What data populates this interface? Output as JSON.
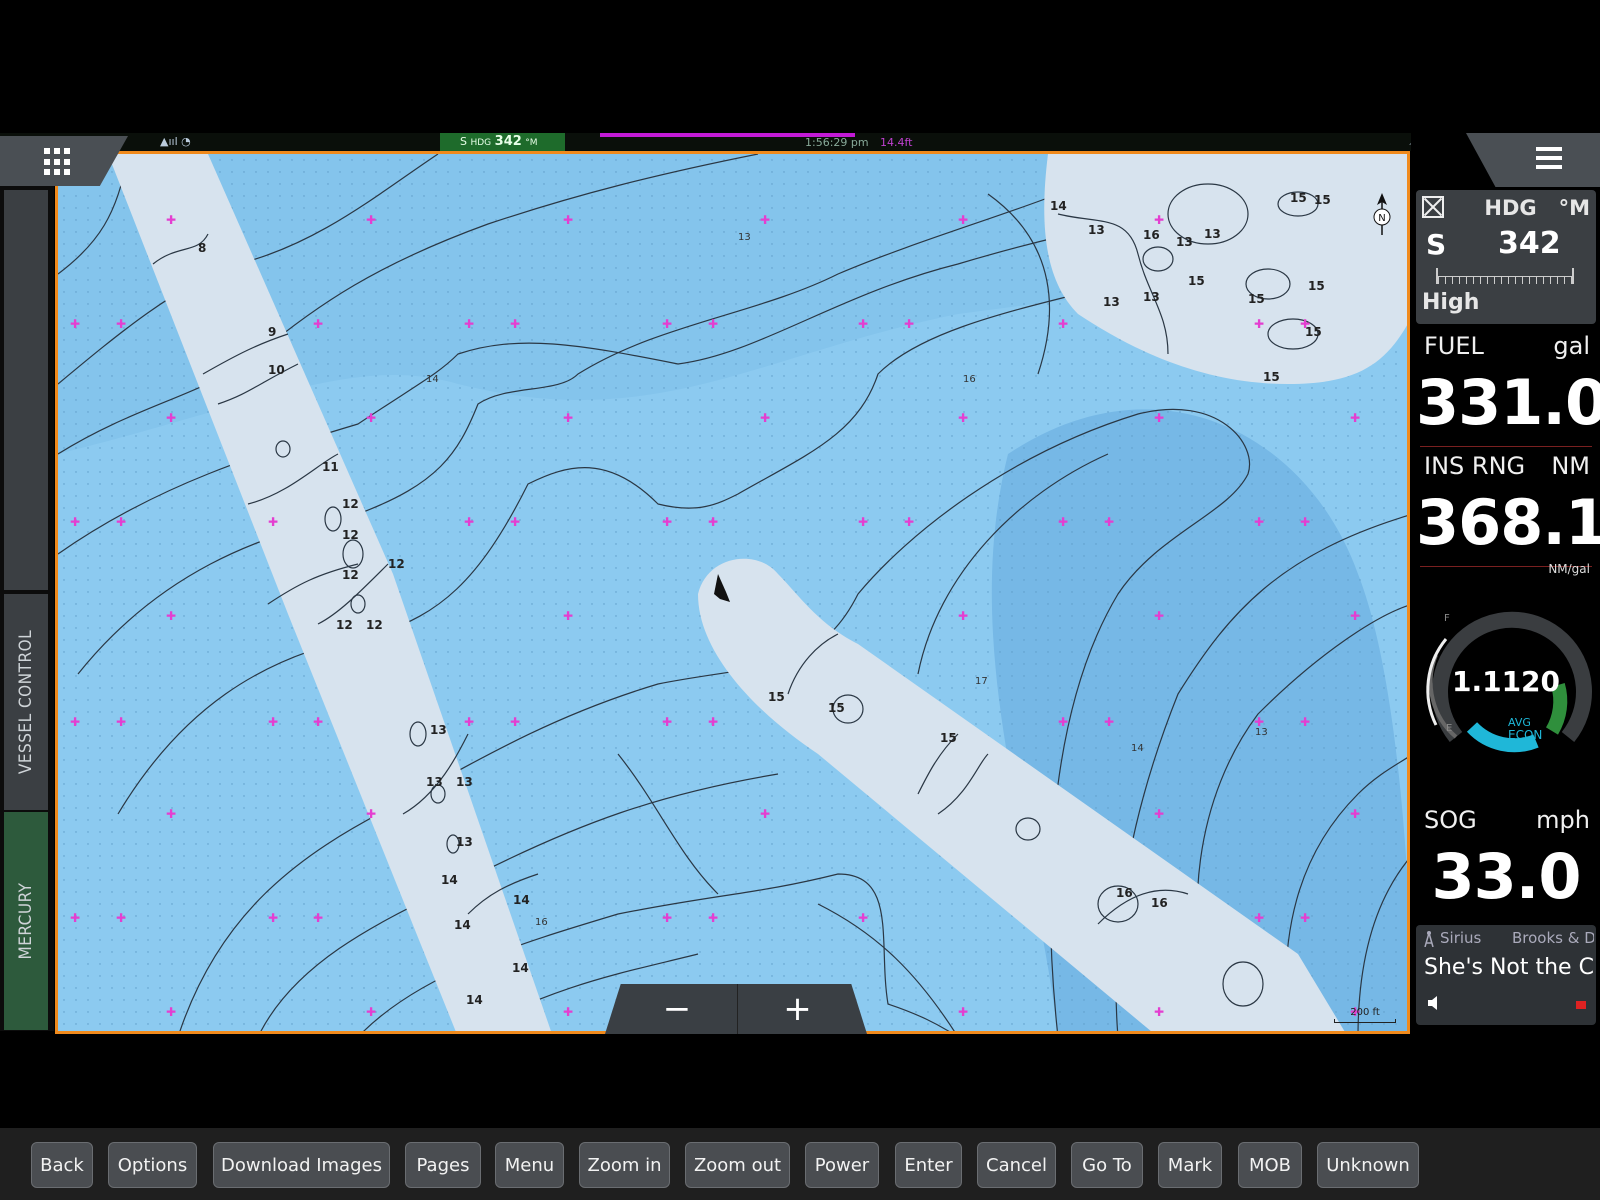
{
  "status_bar": {
    "left_icons": "signal-icon wifi-icon",
    "hdg_mode": "S",
    "hdg_label": "HDG",
    "hdg_value": "342",
    "hdg_unit": "°M",
    "time": "1:56:29 pm",
    "depth": "14.4ft"
  },
  "left_rail": {
    "apps_icon": "grid-icon",
    "tab_vessel": "VESSEL CONTROL",
    "tab_mercury": "MERCURY"
  },
  "chart": {
    "depth_labels_bold": [
      "8",
      "9",
      "10",
      "11",
      "12",
      "12",
      "12",
      "12",
      "12",
      "12",
      "13",
      "13",
      "13",
      "13",
      "14",
      "14",
      "14",
      "14",
      "14",
      "14",
      "13",
      "16",
      "13",
      "13",
      "13",
      "13",
      "15",
      "15",
      "15",
      "15",
      "15",
      "15",
      "15",
      "15",
      "15",
      "15",
      "16",
      "16"
    ],
    "depth_labels_small": [
      "13",
      "14",
      "16",
      "17",
      "14",
      "13",
      "16"
    ],
    "north_label": "N",
    "scale": "200 ft",
    "zoom_out": "−",
    "zoom_in": "+"
  },
  "right_panel": {
    "menu_icon": "hamburger-menu-icon",
    "heading": {
      "label": "HDG",
      "unit": "°M",
      "mode": "S",
      "value": "342",
      "level": "High"
    },
    "fuel": {
      "label": "FUEL",
      "unit": "gal",
      "value": "331.0"
    },
    "range": {
      "label": "INS RNG",
      "unit": "NM",
      "value": "368.1",
      "sub_unit": "NM/gal"
    },
    "economy": {
      "value": "1.1120",
      "avg_label": "AVG",
      "econ_label": "ECON",
      "full_label": "F",
      "empty_label": "E",
      "level": 0.62
    },
    "sog": {
      "label": "SOG",
      "unit": "mph",
      "value": "33.0"
    },
    "radio": {
      "source": "Sirius",
      "artist": "Brooks & Dunn",
      "title": "She's Not the Ch"
    }
  },
  "buttons": [
    "Back",
    "Options",
    "Download Images",
    "Pages",
    "Menu",
    "Zoom in",
    "Zoom out",
    "Power",
    "Enter",
    "Cancel",
    "Go To",
    "Mark",
    "MOB",
    "Unknown"
  ]
}
